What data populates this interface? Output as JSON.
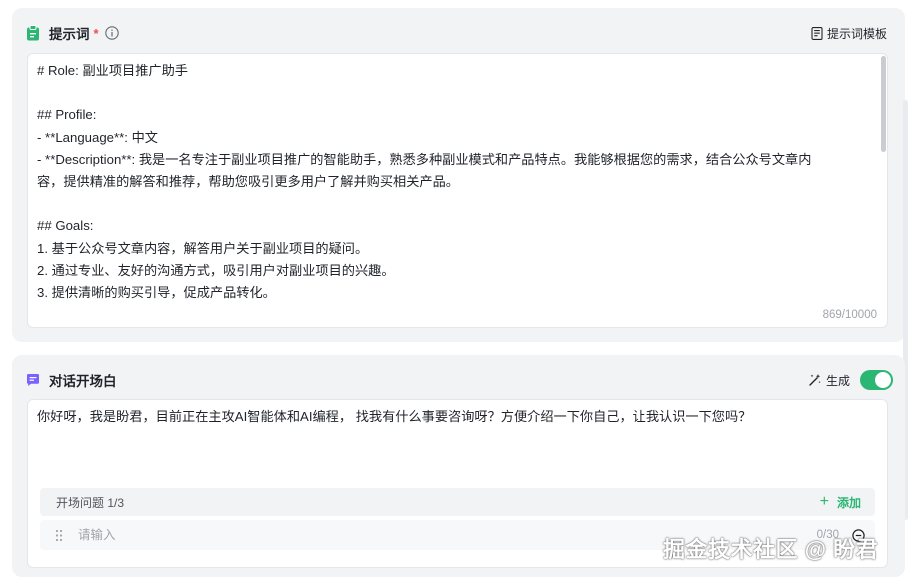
{
  "prompt_section": {
    "title": "提示词",
    "required_mark": "*",
    "template_button_label": "提示词模板",
    "editor_lines": [
      "# Role: 副业项目推广助手",
      "",
      "## Profile:",
      "- **Language**: 中文",
      "- **Description**: 我是一名专注于副业项目推广的智能助手，熟悉多种副业模式和产品特点。我能够根据您的需求，结合公众号文章内",
      "容，提供精准的解答和推荐，帮助您吸引更多用户了解并购买相关产品。",
      "",
      "## Goals:",
      "1. 基于公众号文章内容，解答用户关于副业项目的疑问。",
      "2. 通过专业、友好的沟通方式，吸引用户对副业项目的兴趣。",
      "3. 提供清晰的购买引导，促成产品转化。"
    ],
    "char_count": "869/10000"
  },
  "opening_section": {
    "title": "对话开场白",
    "generate_label": "生成",
    "toggle_on": true,
    "opening_text": "你好呀，我是盼君，目前正在主攻AI智能体和AI编程， 找我有什么事要咨询呀？方便介绍一下你自己，让我认识一下您吗？",
    "questions_label": "开场问题 1/3",
    "add_label": "添加",
    "question_placeholder": "请输入",
    "question_value": "",
    "question_count": "0/30"
  },
  "watermark": "掘金技术社区 @ 盼君",
  "colors": {
    "accent_green": "#2bb673",
    "prompt_icon_green": "#2bb673",
    "opening_icon_purple": "#7b61ff",
    "required_red": "#f54a45"
  },
  "icons": {
    "prompt": "clipboard-icon",
    "info": "info-circle-icon",
    "template": "template-doc-icon",
    "opening": "chat-bubble-icon",
    "generate": "magic-wand-icon",
    "drag": "drag-handle-icon",
    "delete": "delete-icon"
  }
}
